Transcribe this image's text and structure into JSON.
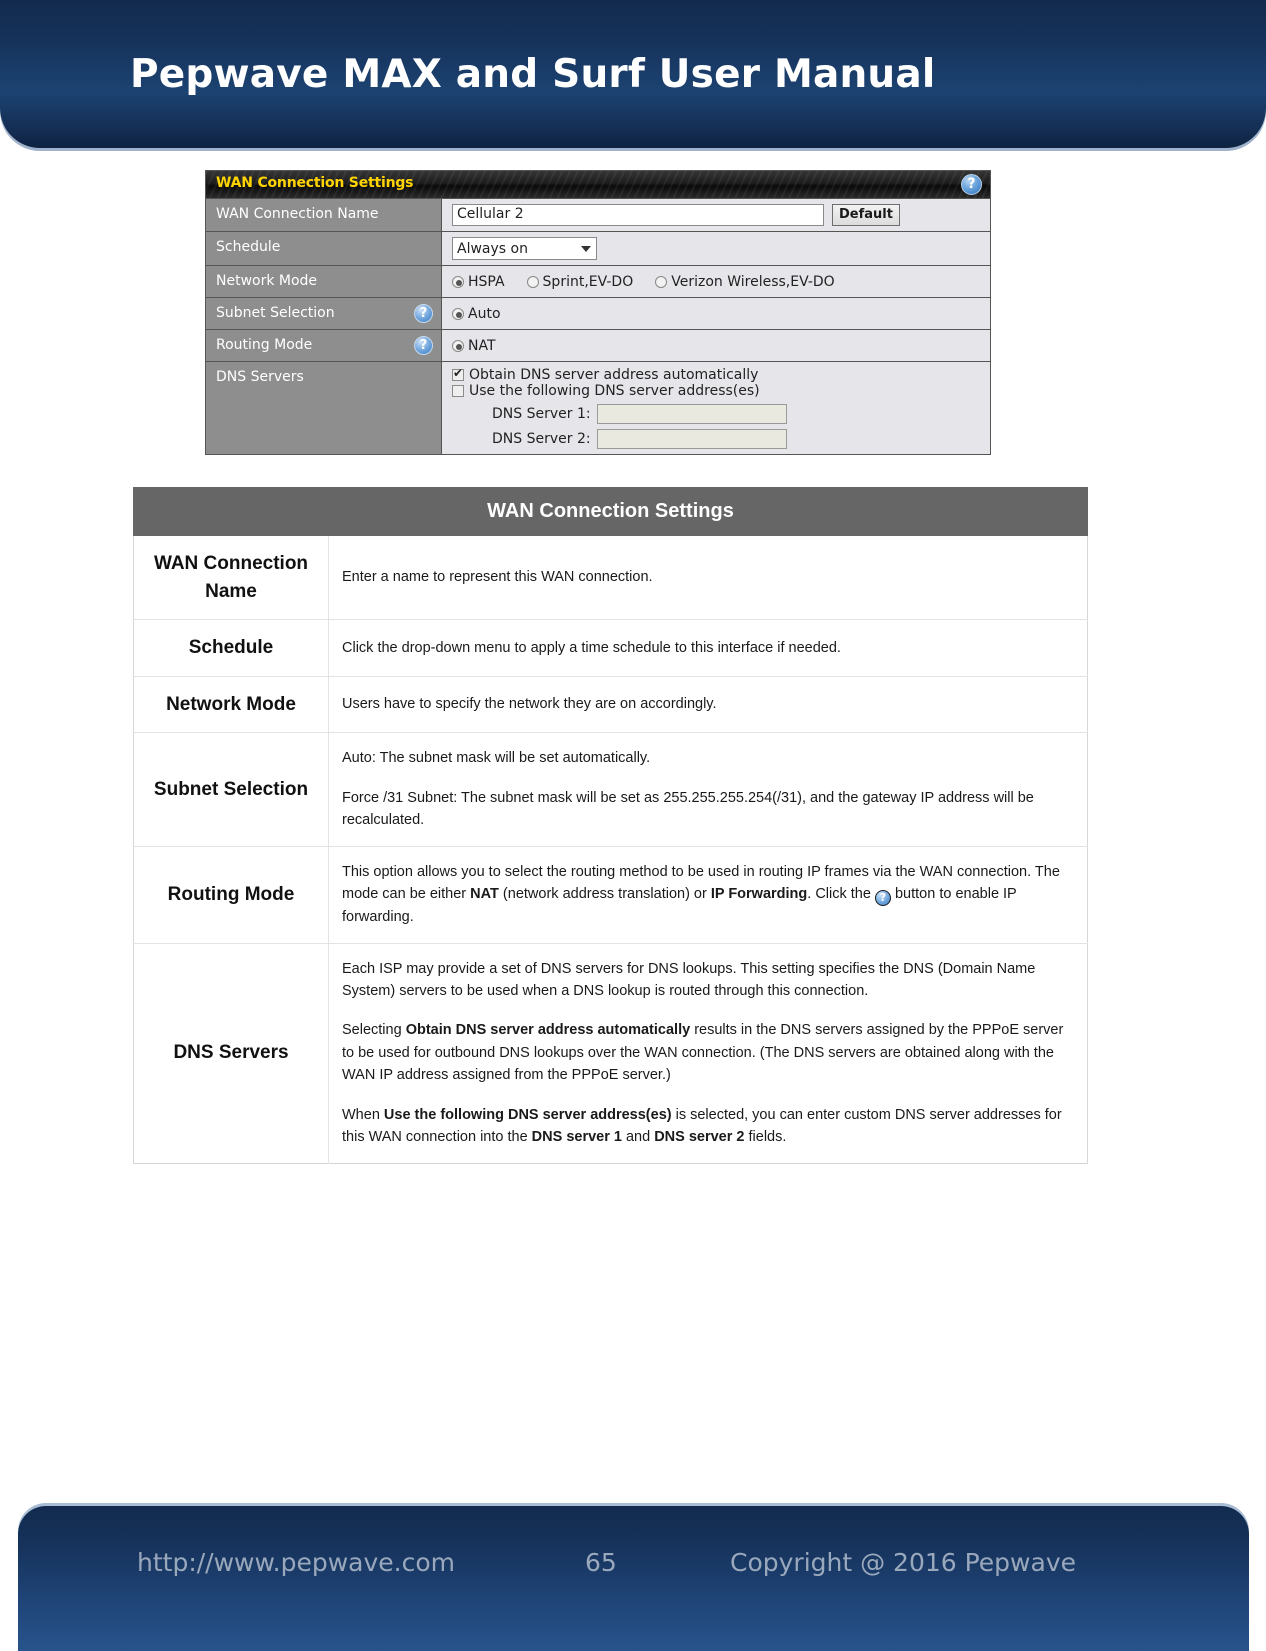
{
  "header": {
    "title": "Pepwave MAX and Surf User Manual"
  },
  "screenshot_panel": {
    "panel_title": "WAN Connection Settings",
    "help_icon": "question-mark-icon",
    "rows": [
      {
        "label": "WAN Connection Name",
        "input_value": "Cellular 2",
        "button_label": "Default"
      },
      {
        "label": "Schedule",
        "select_value": "Always on"
      },
      {
        "label": "Network Mode",
        "options": [
          {
            "label": "HSPA",
            "selected": true
          },
          {
            "label": "Sprint,EV-DO",
            "selected": false
          },
          {
            "label": "Verizon Wireless,EV-DO",
            "selected": false
          }
        ]
      },
      {
        "label": "Subnet Selection",
        "has_help": true,
        "options": [
          {
            "label": "Auto",
            "selected": true
          }
        ]
      },
      {
        "label": "Routing Mode",
        "has_help": true,
        "options": [
          {
            "label": "NAT",
            "selected": true
          }
        ]
      },
      {
        "label": "DNS Servers",
        "checkboxes": [
          {
            "label": "Obtain DNS server address automatically",
            "checked": true
          },
          {
            "label": "Use the following DNS server address(es)",
            "checked": false
          }
        ],
        "fields": [
          {
            "label": "DNS Server 1:",
            "value": ""
          },
          {
            "label": "DNS Server 2:",
            "value": ""
          }
        ]
      }
    ]
  },
  "table": {
    "title": "WAN Connection Settings",
    "rows": [
      {
        "key": "WAN Connection Name",
        "paragraphs": [
          {
            "parts": [
              {
                "t": "Enter a name to represent this WAN connection.",
                "b": false
              }
            ]
          }
        ]
      },
      {
        "key": "Schedule",
        "paragraphs": [
          {
            "parts": [
              {
                "t": "Click the drop-down menu to apply a time schedule to this interface if needed.",
                "b": false
              }
            ]
          }
        ]
      },
      {
        "key": "Network Mode",
        "paragraphs": [
          {
            "parts": [
              {
                "t": "Users have to specify the network they are on accordingly.",
                "b": false
              }
            ]
          }
        ]
      },
      {
        "key": "Subnet Selection",
        "paragraphs": [
          {
            "parts": [
              {
                "t": "Auto: The subnet mask will be set automatically.",
                "b": false
              }
            ]
          },
          {
            "parts": [
              {
                "t": "Force /31 Subnet: The subnet mask will be set as 255.255.255.254(/31), and the gateway IP address will be recalculated.",
                "b": false
              }
            ]
          }
        ]
      },
      {
        "key": "Routing Mode",
        "paragraphs": [
          {
            "parts": [
              {
                "t": "This option allows you to select the routing method to be used in routing IP frames via the WAN connection. The mode can be either ",
                "b": false
              },
              {
                "t": "NAT",
                "b": true
              },
              {
                "t": " (network address translation) or ",
                "b": false
              },
              {
                "t": "IP Forwarding",
                "b": true
              },
              {
                "t": ". Click the ",
                "b": false
              },
              {
                "icon": "question-mark-icon"
              },
              {
                "t": " button to enable IP forwarding.",
                "b": false
              }
            ]
          }
        ]
      },
      {
        "key": "DNS Servers",
        "paragraphs": [
          {
            "parts": [
              {
                "t": "Each ISP may provide a set of DNS servers for DNS lookups. This setting specifies the DNS (Domain Name System) servers to be used when a DNS lookup is routed through this connection.",
                "b": false
              }
            ]
          },
          {
            "parts": [
              {
                "t": "Selecting ",
                "b": false
              },
              {
                "t": "Obtain DNS server address automatically",
                "b": true
              },
              {
                "t": " results in the DNS servers assigned by the PPPoE server to be used for outbound DNS lookups over the WAN connection. (The DNS servers are obtained along with the WAN IP address assigned from the PPPoE server.)",
                "b": false
              }
            ]
          },
          {
            "parts": [
              {
                "t": "When ",
                "b": false
              },
              {
                "t": "Use the following DNS server address(es)",
                "b": true
              },
              {
                "t": " is selected, you can enter custom DNS server addresses for this WAN connection into the ",
                "b": false
              },
              {
                "t": "DNS server 1",
                "b": true
              },
              {
                "t": " and ",
                "b": false
              },
              {
                "t": "DNS server 2",
                "b": true
              },
              {
                "t": " fields.",
                "b": false
              }
            ]
          }
        ]
      }
    ]
  },
  "footer": {
    "url": "http://www.pepwave.com",
    "page": "65",
    "copyright": "Copyright @ 2016 Pepwave"
  },
  "colors": {
    "banner_dark": "#122a4e",
    "banner_light": "#27538c",
    "table_header": "#666666",
    "panel_label_bg": "#8e8e8e",
    "panel_title_text": "#ffd400"
  }
}
